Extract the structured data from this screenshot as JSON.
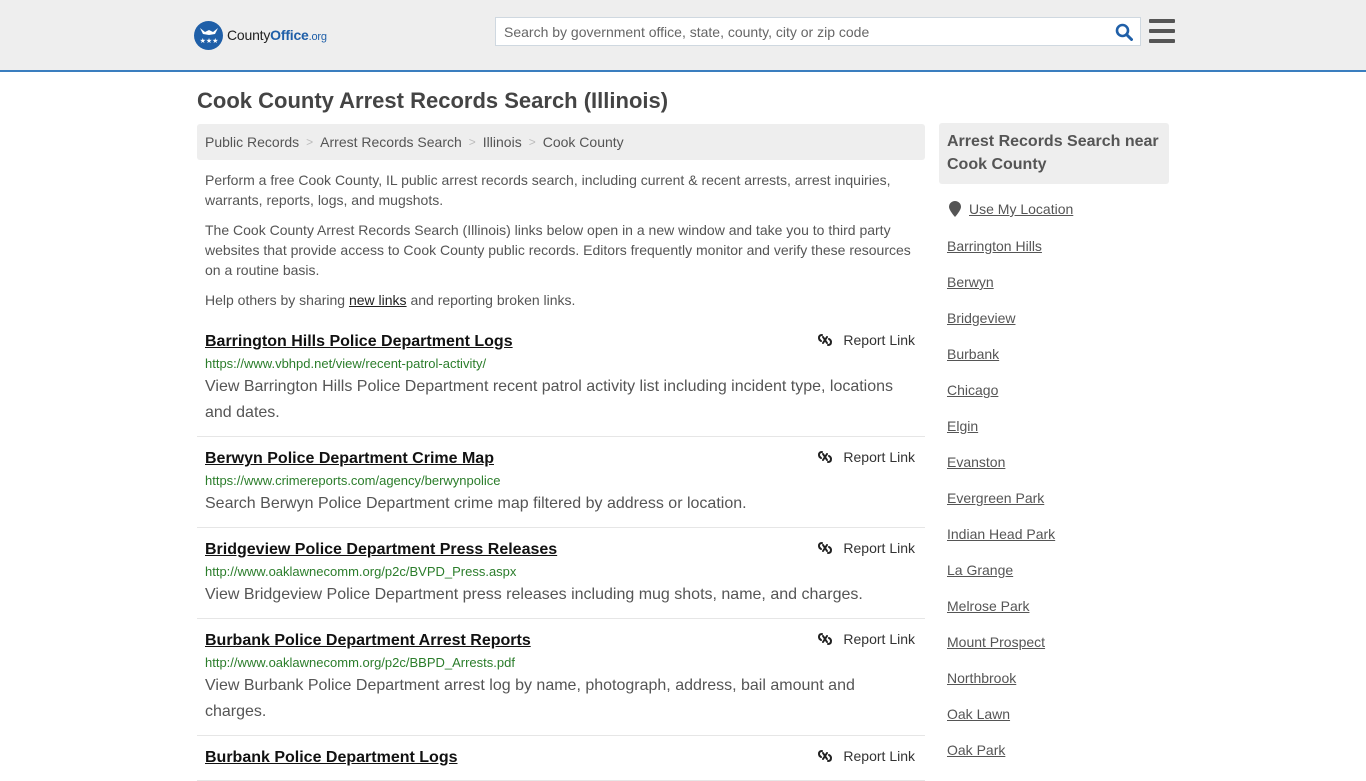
{
  "header": {
    "logo": {
      "name_part1": "County",
      "name_part2": "Office",
      "name_part3": ".org"
    },
    "search": {
      "placeholder": "Search by government office, state, county, city or zip code",
      "value": ""
    },
    "colors": {
      "brand": "#1f5fa8",
      "header_bg": "#eeeeee",
      "header_border": "#3a7ebf"
    }
  },
  "page": {
    "title": "Cook County Arrest Records Search (Illinois)",
    "breadcrumb": [
      {
        "label": "Public Records"
      },
      {
        "label": "Arrest Records Search"
      },
      {
        "label": "Illinois"
      },
      {
        "label": "Cook County"
      }
    ],
    "intro": {
      "p1": "Perform a free Cook County, IL public arrest records search, including current & recent arrests, arrest inquiries, warrants, reports, logs, and mugshots.",
      "p2": "The Cook County Arrest Records Search (Illinois) links below open in a new window and take you to third party websites that provide access to Cook County public records. Editors frequently monitor and verify these resources on a routine basis.",
      "p3_before": "Help others by sharing ",
      "p3_link": "new links",
      "p3_after": " and reporting broken links."
    },
    "report_label": "Report Link",
    "results": [
      {
        "title": "Barrington Hills Police Department Logs",
        "url": "https://www.vbhpd.net/view/recent-patrol-activity/",
        "desc": "View Barrington Hills Police Department recent patrol activity list including incident type, locations and dates."
      },
      {
        "title": "Berwyn Police Department Crime Map",
        "url": "https://www.crimereports.com/agency/berwynpolice",
        "desc": "Search Berwyn Police Department crime map filtered by address or location."
      },
      {
        "title": "Bridgeview Police Department Press Releases",
        "url": "http://www.oaklawnecomm.org/p2c/BVPD_Press.aspx",
        "desc": "View Bridgeview Police Department press releases including mug shots, name, and charges."
      },
      {
        "title": "Burbank Police Department Arrest Reports",
        "url": "http://www.oaklawnecomm.org/p2c/BBPD_Arrests.pdf",
        "desc": "View Burbank Police Department arrest log by name, photograph, address, bail amount and charges."
      },
      {
        "title": "Burbank Police Department Logs",
        "url": "",
        "desc": ""
      }
    ]
  },
  "sidebar": {
    "heading": "Arrest Records Search near Cook County",
    "use_location": "Use My Location",
    "places": [
      "Barrington Hills",
      "Berwyn",
      "Bridgeview",
      "Burbank",
      "Chicago",
      "Elgin",
      "Evanston",
      "Evergreen Park",
      "Indian Head Park",
      "La Grange",
      "Melrose Park",
      "Mount Prospect",
      "Northbrook",
      "Oak Lawn",
      "Oak Park"
    ]
  }
}
